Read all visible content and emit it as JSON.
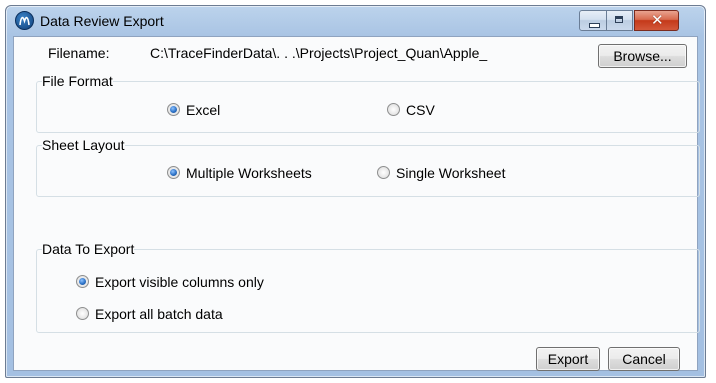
{
  "window": {
    "title": "Data Review Export",
    "controls": {
      "minimize": "minimize",
      "maximize": "maximize",
      "close": "✕"
    }
  },
  "filename": {
    "label": "Filename:",
    "value": "C:\\TraceFinderData\\. . .\\Projects\\Project_Quan\\Apple_",
    "browse_label": "Browse..."
  },
  "file_format": {
    "title": "File Format",
    "options": [
      {
        "label": "Excel",
        "checked": true
      },
      {
        "label": "CSV",
        "checked": false
      }
    ]
  },
  "sheet_layout": {
    "title": "Sheet Layout",
    "options": [
      {
        "label": "Multiple Worksheets",
        "checked": true
      },
      {
        "label": "Single Worksheet",
        "checked": false
      }
    ]
  },
  "data_to_export": {
    "title": "Data To Export",
    "options": [
      {
        "label": "Export visible columns only",
        "checked": true
      },
      {
        "label": "Export all batch data",
        "checked": false
      }
    ]
  },
  "footer": {
    "export_label": "Export",
    "cancel_label": "Cancel"
  },
  "colors": {
    "title_gradient_top": "#bcd3ec",
    "title_gradient_bottom": "#a4c0e2",
    "close_button": "#c4391a",
    "radio_selected": "#2c72c7",
    "client_bg": "#fafbfc"
  }
}
